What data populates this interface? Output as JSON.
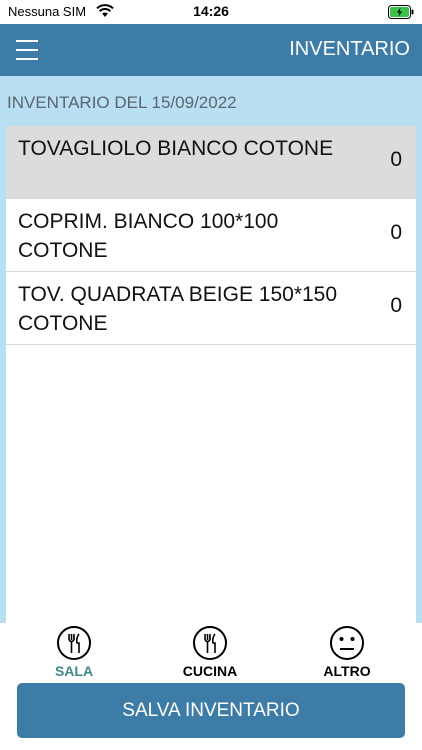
{
  "status_bar": {
    "carrier": "Nessuna SIM",
    "time": "14:26"
  },
  "app_bar": {
    "title": "INVENTARIO"
  },
  "heading": "INVENTARIO DEL 15/09/2022",
  "items": [
    {
      "name": "TOVAGLIOLO BIANCO COTONE",
      "qty": "0",
      "selected": true
    },
    {
      "name": "COPRIM. BIANCO 100*100 COTONE",
      "qty": "0",
      "selected": false
    },
    {
      "name": "TOV. QUADRATA BEIGE 150*150 COTONE",
      "qty": "0",
      "selected": false
    }
  ],
  "tabs": [
    {
      "label": "SALA",
      "icon": "fork-knife-icon",
      "active": true
    },
    {
      "label": "CUCINA",
      "icon": "fork-knife-icon",
      "active": false
    },
    {
      "label": "ALTRO",
      "icon": "neutral-face-icon",
      "active": false
    }
  ],
  "save_button": {
    "label": "SALVA INVENTARIO"
  },
  "colors": {
    "app_bar": "#3d7ca6",
    "background": "#b9dff2",
    "active_tab": "#3d8a86",
    "battery": "#3ac14a"
  }
}
